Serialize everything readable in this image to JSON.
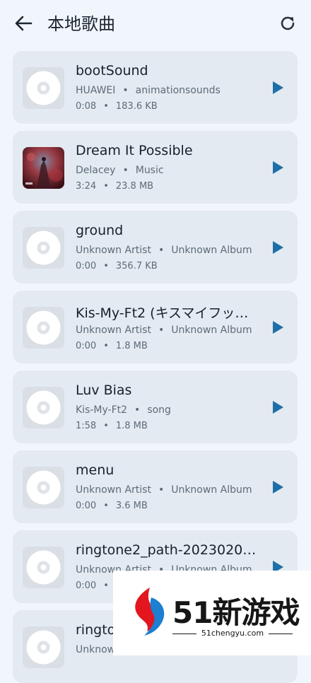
{
  "header": {
    "title": "本地歌曲"
  },
  "songs": [
    {
      "title": "bootSound",
      "artist": "HUAWEI",
      "album": "animationsounds",
      "duration": "0:08",
      "size": "183.6 KB",
      "cover": "disc-icon"
    },
    {
      "title": "Dream It Possible",
      "artist": "Delacey",
      "album": "Music",
      "duration": "3:24",
      "size": "23.8 MB",
      "cover": "album-art"
    },
    {
      "title": "ground",
      "artist": "Unknown Artist",
      "album": "Unknown Album",
      "duration": "0:00",
      "size": "356.7 KB",
      "cover": "disc-icon"
    },
    {
      "title": "Kis-My-Ft2 (キスマイフッ…",
      "artist": "Unknown Artist",
      "album": "Unknown Album",
      "duration": "0:00",
      "size": "1.8 MB",
      "cover": "disc-icon"
    },
    {
      "title": "Luv Bias",
      "artist": "Kis-My-Ft2",
      "album": "song",
      "duration": "1:58",
      "size": "1.8 MB",
      "cover": "disc-icon"
    },
    {
      "title": "menu",
      "artist": "Unknown Artist",
      "album": "Unknown Album",
      "duration": "0:00",
      "size": "3.6 MB",
      "cover": "disc-icon"
    },
    {
      "title": "ringtone2_path-2023020…",
      "artist": "Unknown Artist",
      "album": "Unknown Album",
      "duration": "0:00",
      "size": "",
      "cover": "disc-icon"
    },
    {
      "title": "ringto",
      "artist": "Unknow",
      "album": "",
      "duration": "",
      "size": "",
      "cover": "disc-icon"
    }
  ],
  "separator": "•",
  "watermark": {
    "brand": "51新游戏",
    "site": "51chengyu.com"
  },
  "colors": {
    "accent": "#1f6fa6",
    "card": "#e3eaf2",
    "background": "#f1f6fc"
  }
}
